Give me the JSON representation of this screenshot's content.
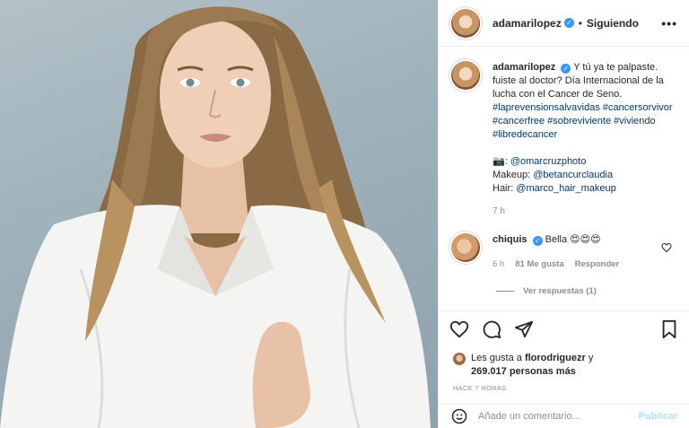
{
  "post": {
    "author": "adamarilopez",
    "follow_status": "Siguiendo",
    "header_separator": "•",
    "more_icon": "more-horizontal-icon",
    "verified_icon": "verified-check-icon"
  },
  "caption": {
    "author": "adamarilopez",
    "text": "Y tú ya te palpaste. fuiste al doctor? Día Internacional de la lucha con el Cancer de Seno.",
    "hashtags": "#laprevensionsalvavidas #cancersorvivor #cancerfree #sobreviviente #viviendo #libredecancer",
    "credit_photo_prefix": "📷: ",
    "credit_photo_handle": "@omarcruzphoto",
    "credit_makeup_prefix": "Makeup: ",
    "credit_makeup_handle": "@betancurclaudia",
    "credit_hair_prefix": "Hair: ",
    "credit_hair_handle": "@marco_hair_makeup",
    "time": "7 h"
  },
  "comment": {
    "author": "chiquis",
    "text": "Bella 😍😍😍",
    "time": "6 h",
    "likes": "81 Me gusta",
    "reply": "Responder",
    "view_replies": "Ver respuestas (1)"
  },
  "likes": {
    "prefix": "Les gusta a ",
    "user": "florodriguezr",
    "connector": " y",
    "count": "269.017 personas más"
  },
  "timestamp": "HACE 7 HORAS",
  "add_comment": {
    "placeholder": "Añade un comentario...",
    "publish": "Publicar"
  },
  "colors": {
    "accent": "#3897f0",
    "link": "#00376b",
    "muted": "#8e8e8e",
    "publish_disabled": "#b2dffc"
  }
}
